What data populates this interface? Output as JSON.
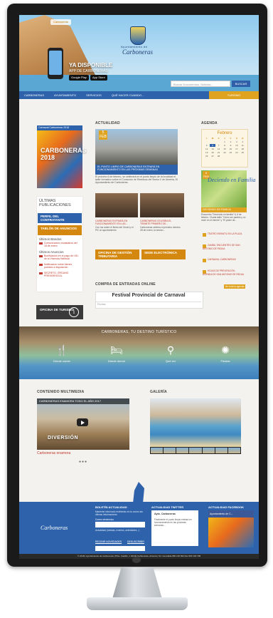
{
  "header": {
    "top_badge": "Carboneras",
    "app_line1": "YA DISPONIBLE",
    "app_line2": "APP DE CARBONERAS",
    "google_play": "Google Play",
    "app_store": "App Store",
    "town_sub": "Ayuntamiento de",
    "town_name": "Carboneras",
    "search_placeholder": "Buscar Documentos, Noticias...",
    "search_button": "BUSCAR"
  },
  "nav": {
    "items": [
      "CARBONERAS",
      "AYUNTAMIENTO",
      "SERVICIOS",
      "QUÉ HACER CUANDO..."
    ],
    "right": "TURISMO"
  },
  "left": {
    "poster_title": "Carnaval Carboneras 2018",
    "poster_big": "CARBONERAS 2018",
    "pubs_title": "ÚLTIMAS PUBLICACIONES",
    "btn_perfil": "PERFIL DEL CONTRATANTE",
    "btn_tablon": "TABLÓN DE ANUNCIOS",
    "ultimos_bandos": "Últimos Bandos",
    "bando1": "Comunicación ciudadanos del 18 de enero",
    "ultimos_anuncios": "Últimos Anuncios",
    "anuncio1": "Bonificación en el pago de I.B.I. de la Vivienda Habitual",
    "anuncio2": "Notificación sobre bienes puestos a disposición",
    "anuncio3": "SECRETO, ÓRGANO PRESIDENCIAL",
    "tourism_btn": "OFICINA DE TURISMO",
    "tourism_icon": "i"
  },
  "news": {
    "title": "ACTUALIDAD",
    "date_day": "5",
    "date_month": "FEB",
    "main_caption": "EL PUNTO LIMPIO DE CARBONERAS ENTRARÁ EN FUNCIONAMIENTO EN LAS PRÓXIMAS SEMANAS",
    "main_body": "El próximo 6 de febrero, se celebrará en el punto limpio de la localidad el taller formativo sobre el Consorcio de Residuos del Sector II de Almería, El Ayuntamiento de Carboneras.",
    "thumb1": "CARBONERAS ENTRARÁ EN FUNCIONAMIENTO EN LAS...",
    "thumb1_body": "Con los sobre el fluido del Ocoel y el PIC al ayuntamiento",
    "thumb2": "CARBONERAS CELEBRA EL TRÁMITE PRIMERO DE...",
    "thumb2_body": "Carboneras celebra el próximo viernes 28 de enero, la sesión...",
    "tile1": "OFICINA DE GESTIÓN TRIBUTARIA",
    "tile2": "SEDE ELECTRÓNICA",
    "purchase_heading": "COMPRA DE ENTRADAS ONLINE",
    "purchase_title": "Festival Provincial de Carnaval",
    "purchase_field": "Fechas"
  },
  "agenda": {
    "title": "AGENDA",
    "month": "Febrero",
    "weekdays": [
      "L",
      "M",
      "X",
      "J",
      "V",
      "S",
      "D"
    ],
    "days": [
      "",
      "",
      "",
      "1",
      "2",
      "3",
      "4",
      "5",
      "6",
      "7",
      "8",
      "9",
      "10",
      "11",
      "12",
      "13",
      "14",
      "15",
      "16",
      "17",
      "18",
      "19",
      "20",
      "21",
      "22",
      "23",
      "24",
      "25",
      "26",
      "27",
      "28",
      "",
      "",
      "",
      ""
    ],
    "today": "6",
    "image_text": "Decíendo en Familia",
    "image_day": "6",
    "image_month": "FEB",
    "caption": "DECIENDO EN FAMILIA",
    "note": "Encuentro \"Decíendo en familia\" 6, 8 de febrero. Charla taller \"Cómo ser padres y no morir en el intento\" y \"El poder de...",
    "items": [
      "TEATRO INFANTIL EN LA PLAZA",
      "ZAMBA. ENCUENTRO DE SAN ANTONIO DE PADUA",
      "CARNAVAL CARBONERAS",
      "HOJAS DE PREVENCIÓN - AGENDA DE SAN ANTONIO DE PADUA"
    ],
    "more": "Ver toda la agenda"
  },
  "destino": {
    "title": "CARBONERAS, TU DESTINO TURÍSTICO",
    "labels": [
      "Dónde comer",
      "Dónde dormir",
      "Qué ver",
      "Fiestas"
    ]
  },
  "multimedia": {
    "title": "CONTENIDO MULTIMEDIA",
    "video_title": "CARBONERAS ENAMORA TODO EL AÑO 2017",
    "video_word": "DIVERSIÓN",
    "caption": "Carboneras enamora",
    "dots": "●●●"
  },
  "gallery": {
    "title": "GALERÍA"
  },
  "footer": {
    "logo": "Carboneras",
    "boletin": "BOLETÍN ACTUALIDAD",
    "boletin_text": "Mantente informado recibiendo en tu correo las últimas informaciones",
    "email_label": "Correo electrónico",
    "checkbox_label": "Actualidad (noticias, eventos, actividades...)",
    "recibir": "RECIBIR NOVEDADES",
    "desuscribir": "DESUSCRIBIR",
    "twitter": "ACTUALIDAD TWITTER",
    "twitter_user": "Ayto. Carboneras",
    "twitter_text": "Finalmente el punto limpio entrará en funcionamiento en las próximas semanas...",
    "facebook": "ACTUALIDAD FACEBOOK",
    "fb_page": "Ayuntamiento de C...",
    "copyright": "© 2018 | Ayuntamiento de Carboneras | Plza. Castillo, 1 04140 Carboneras, Almería | Tel. Centralita 950 136 052 Fax 950 130 708"
  }
}
